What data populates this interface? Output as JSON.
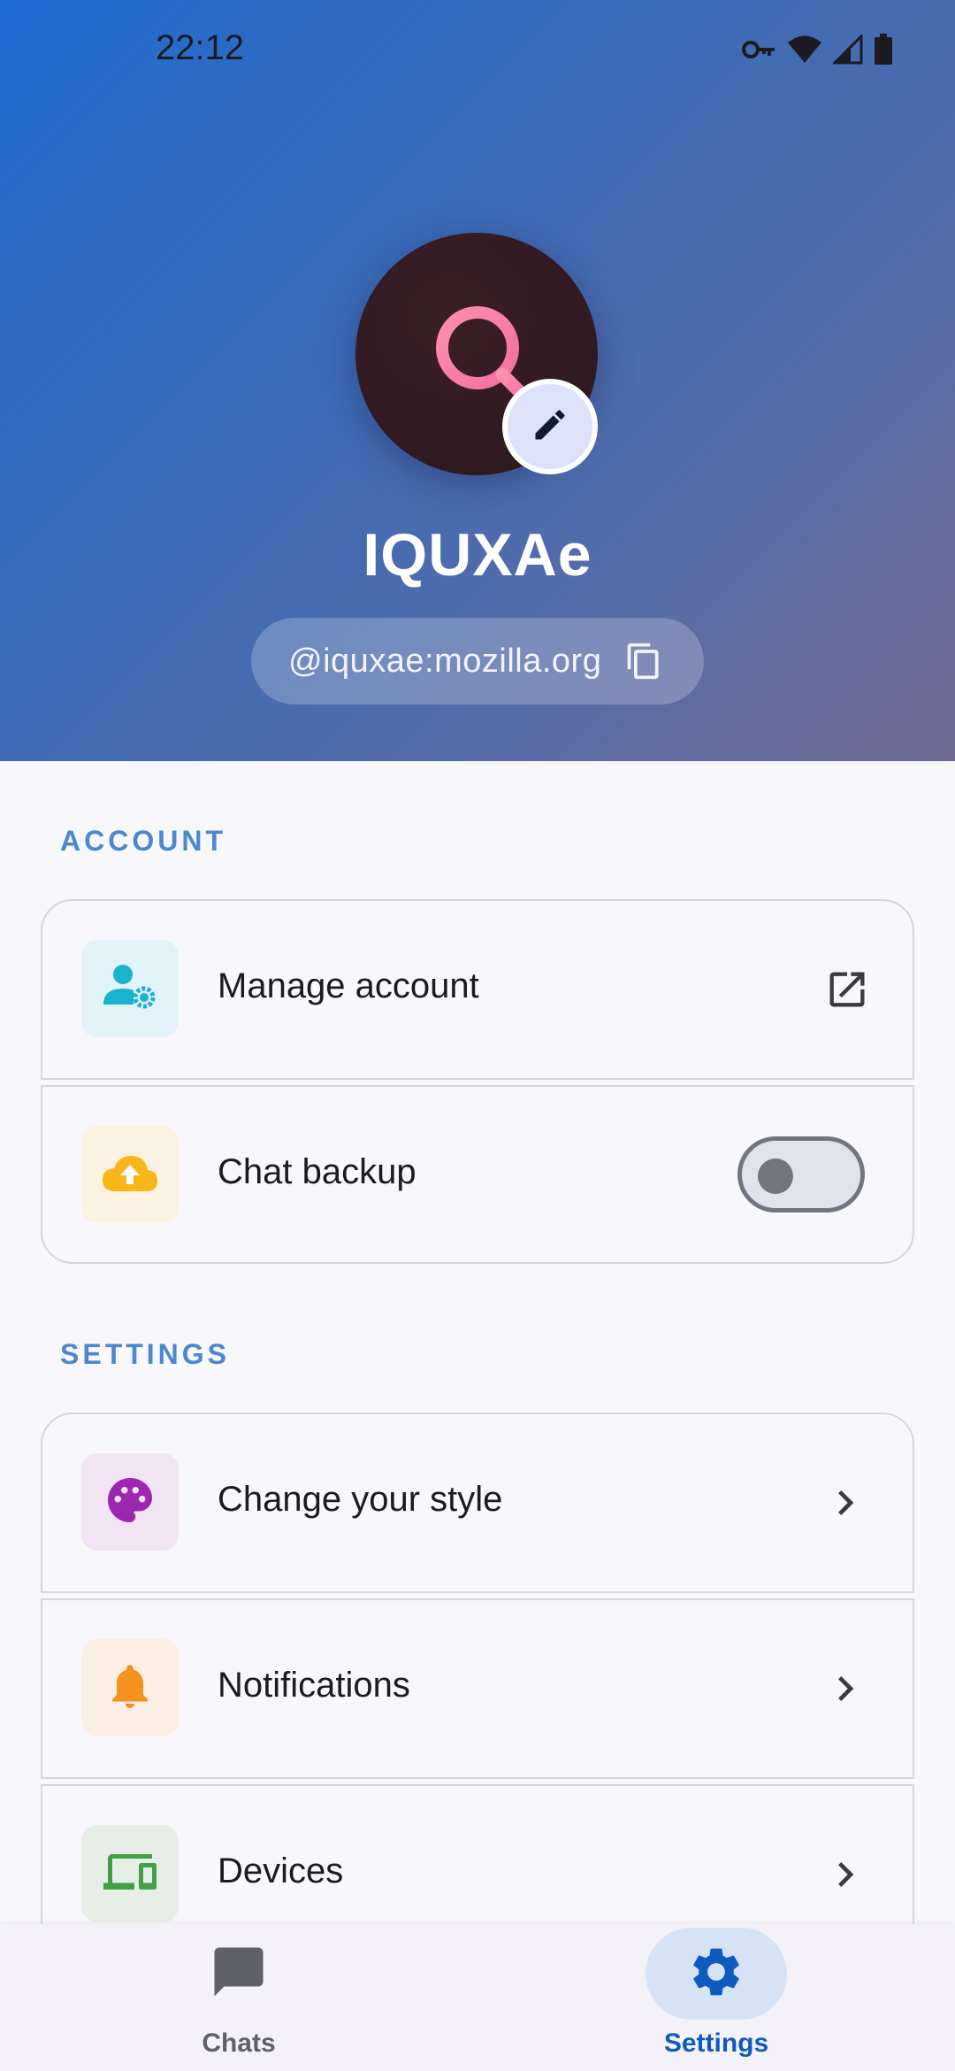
{
  "status_bar": {
    "time": "22:12",
    "icons": [
      "vpn-key-icon",
      "wifi-icon",
      "signal-icon",
      "battery-icon"
    ]
  },
  "profile": {
    "display_name": "IQUXAe",
    "user_id": "@iquxae:mozilla.org",
    "avatar_icon": "magnifier-icon",
    "edit_icon": "pencil-icon",
    "copy_icon": "copy-icon"
  },
  "account_section": {
    "label": "ACCOUNT",
    "items": [
      {
        "label": "Manage account",
        "icon": "user-gear-icon",
        "trailing": "open-external-icon",
        "icon_color": "#19b2cf",
        "icon_bg": "#e1f3f8"
      },
      {
        "label": "Chat backup",
        "icon": "cloud-upload-icon",
        "trailing": "toggle",
        "toggle_on": false,
        "icon_color": "#f7b719",
        "icon_bg": "#fbf2e2"
      }
    ]
  },
  "settings_section": {
    "label": "SETTINGS",
    "items": [
      {
        "label": "Change your style",
        "icon": "palette-icon",
        "trailing": "chevron-right-icon",
        "icon_color": "#9c27b0",
        "icon_bg": "#f1e4f4"
      },
      {
        "label": "Notifications",
        "icon": "bell-icon",
        "trailing": "chevron-right-icon",
        "icon_color": "#f5921e",
        "icon_bg": "#fbeee4"
      },
      {
        "label": "Devices",
        "icon": "devices-icon",
        "trailing": "chevron-right-icon",
        "icon_color": "#43a047",
        "icon_bg": "#e6efe7"
      }
    ]
  },
  "bottom_nav": {
    "items": [
      {
        "label": "Chats",
        "icon": "chat-bubble-icon",
        "active": false
      },
      {
        "label": "Settings",
        "icon": "gear-icon",
        "active": true
      }
    ],
    "active_color": "#0d5bbf",
    "inactive_color": "#5f6068"
  }
}
